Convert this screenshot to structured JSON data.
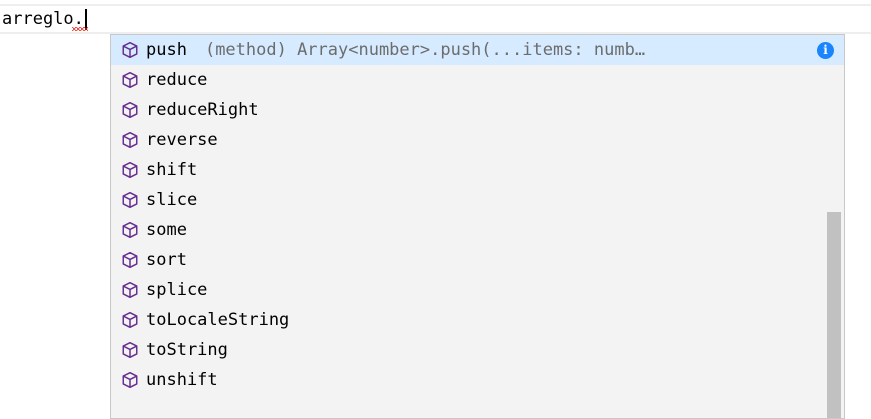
{
  "editor": {
    "code_prefix": "arreglo",
    "code_dot": "."
  },
  "suggestions": {
    "item_icon": "method-cube-icon",
    "icon_color": "#652d90",
    "selected_bg": "#d6ebff",
    "info_icon_text": "i",
    "items": [
      {
        "label": "push",
        "detail": "(method) Array<number>.push(...items: numb…"
      },
      {
        "label": "reduce"
      },
      {
        "label": "reduceRight"
      },
      {
        "label": "reverse"
      },
      {
        "label": "shift"
      },
      {
        "label": "slice"
      },
      {
        "label": "some"
      },
      {
        "label": "sort"
      },
      {
        "label": "splice"
      },
      {
        "label": "toLocaleString"
      },
      {
        "label": "toString"
      },
      {
        "label": "unshift"
      }
    ],
    "selected_index": 0
  }
}
